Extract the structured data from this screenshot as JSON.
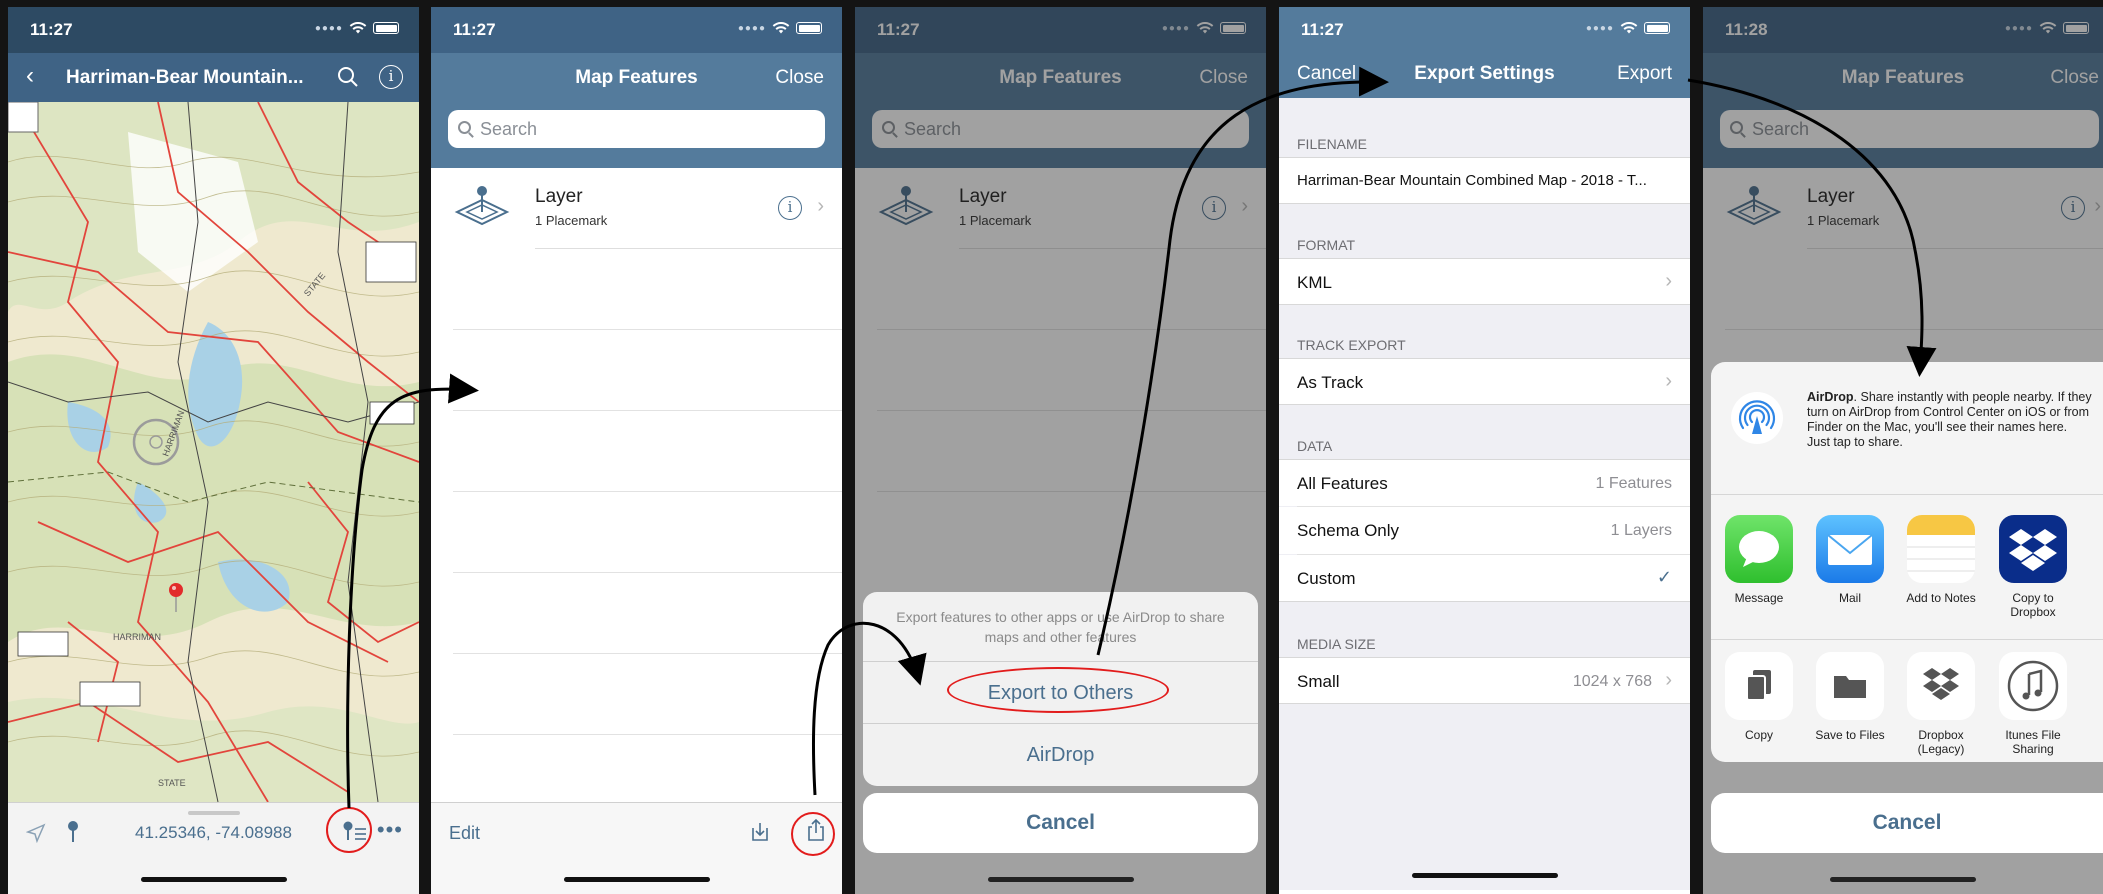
{
  "status": {
    "screen1_time": "11:27",
    "screen2_time": "11:27",
    "screen3_time": "11:27",
    "screen4_time": "11:27",
    "screen5_time": "11:28"
  },
  "screen1": {
    "title": "Harriman-Bear Mountain...",
    "coordinates": "41.25346, -74.08988",
    "map_labels": [
      "HARRIMAN",
      "STATE",
      "HARRIMAN",
      "STATE"
    ]
  },
  "screen2": {
    "title": "Map Features",
    "close": "Close",
    "search_placeholder": "Search",
    "layer_name": "Layer",
    "layer_sub": "1 Placemark",
    "edit": "Edit"
  },
  "screen3": {
    "title": "Map Features",
    "close": "Close",
    "search_placeholder": "Search",
    "layer_name": "Layer",
    "layer_sub": "1 Placemark",
    "sheet_message": "Export features to other apps or use AirDrop to share maps and other features",
    "export_to_others": "Export to Others",
    "airdrop": "AirDrop",
    "cancel": "Cancel"
  },
  "screen4": {
    "cancel": "Cancel",
    "title": "Export Settings",
    "export": "Export",
    "filename_header": "FILENAME",
    "filename_value": "Harriman-Bear Mountain Combined Map - 2018 - T...",
    "format_header": "FORMAT",
    "format_value": "KML",
    "track_header": "TRACK EXPORT",
    "track_value": "As Track",
    "data_header": "DATA",
    "all_features": "All Features",
    "all_features_val": "1 Features",
    "schema_only": "Schema Only",
    "schema_only_val": "1 Layers",
    "custom": "Custom",
    "custom_check": "✓",
    "media_header": "MEDIA SIZE",
    "media_value": "Small",
    "media_size": "1024 x 768"
  },
  "screen5": {
    "title": "Map Features",
    "close": "Close",
    "search_placeholder": "Search",
    "layer_name": "Layer",
    "layer_sub": "1 Placemark",
    "airdrop_bold": "AirDrop",
    "airdrop_text": ". Share instantly with people nearby. If they turn on AirDrop from Control Center on iOS or from Finder on the Mac, you'll see their names here. Just tap to share.",
    "apps": [
      "Message",
      "Mail",
      "Add to Notes",
      "Copy to Dropbox"
    ],
    "actions": [
      "Copy",
      "Save to Files",
      "Dropbox (Legacy)",
      "Itunes File Sharing"
    ],
    "cancel": "Cancel"
  },
  "colors": {
    "nav_blue": "#547b9c",
    "accent_blue": "#4a6f8e",
    "annotation_red": "#e21c1c"
  }
}
